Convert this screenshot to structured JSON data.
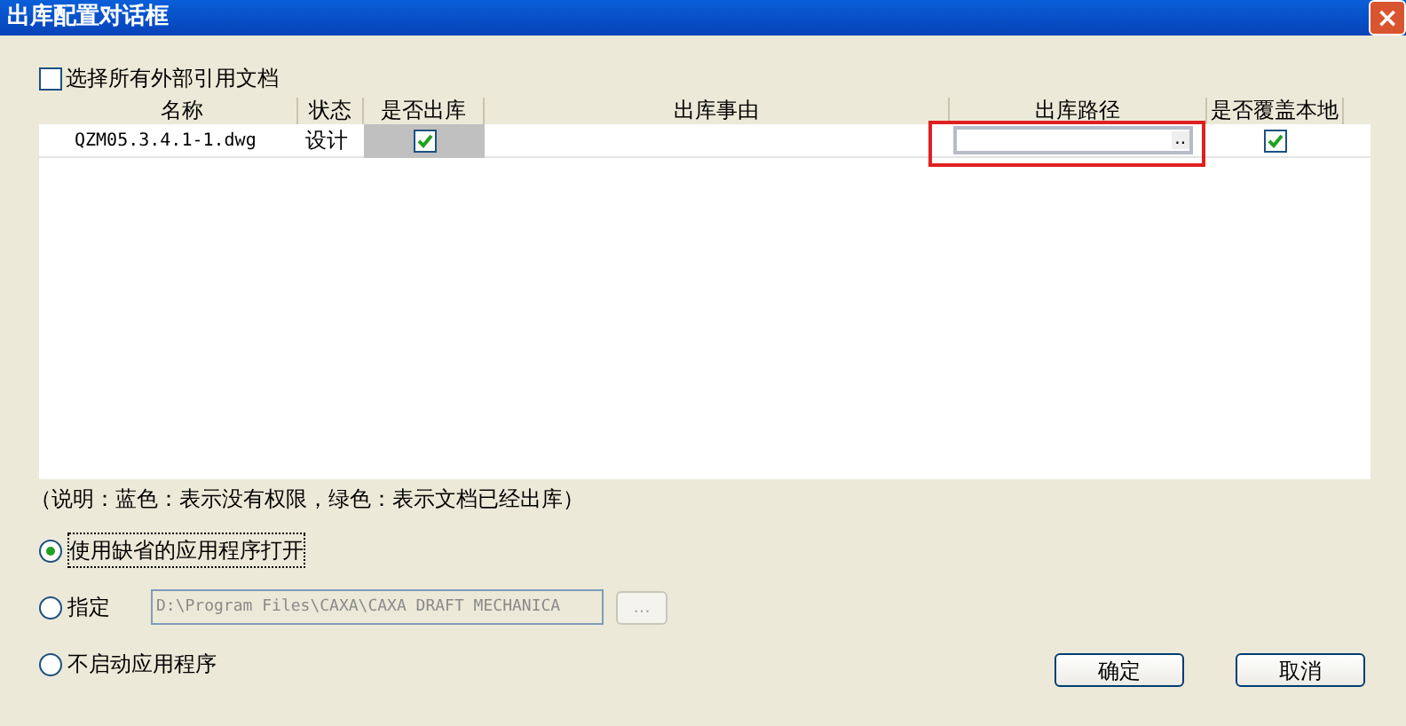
{
  "window": {
    "title": "出库配置对话框",
    "close_button": "×"
  },
  "select_all": {
    "label": "选择所有外部引用文档",
    "checked": false
  },
  "table": {
    "columns": [
      "名称",
      "状态",
      "是否出库",
      "出库事由",
      "出库路径",
      "是否覆盖本地"
    ],
    "rows": [
      {
        "name": "QZM05.3.4.1-1.dwg",
        "status": "设计",
        "checkout": true,
        "reason": "",
        "path_button": "..",
        "overwrite": true,
        "highlighted": true
      }
    ]
  },
  "note": "（说明：蓝色：表示没有权限，绿色：表示文档已经出库）",
  "options": [
    {
      "label": "使用缺省的应用程序打开",
      "selected": true,
      "kind": "plain"
    },
    {
      "label": "指定",
      "selected": false,
      "kind": "path",
      "value": "D:\\Program Files\\CAXA\\CAXA DRAFT MECHANICA",
      "browse": "..."
    },
    {
      "label": "不启动应用程序",
      "selected": false,
      "kind": "plain"
    }
  ],
  "buttons": [
    "确定",
    "取消"
  ]
}
